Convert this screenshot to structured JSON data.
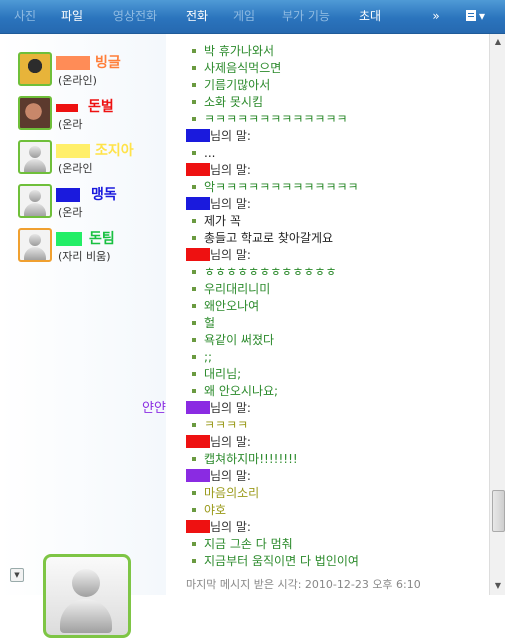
{
  "tabs": [
    {
      "label": "사진"
    },
    {
      "label": "파일"
    },
    {
      "label": "영상전화"
    },
    {
      "label": "전화"
    },
    {
      "label": "게임"
    },
    {
      "label": "부가 기능"
    },
    {
      "label": "초대"
    }
  ],
  "toolbar": {
    "more_label": "»",
    "menu_icon": "menu-icon",
    "menu_arrow": "▾"
  },
  "contacts": [
    {
      "name": "빙글",
      "name_color": "#ff7f3a",
      "status": "(온라인)",
      "redact_color": "#ff8c57"
    },
    {
      "name": "돈벌",
      "name_color": "#ee1111",
      "status": "(온라",
      "redact_color": "#ee1111"
    },
    {
      "name": "조지아",
      "name_color": "#ffe34a",
      "status": "(온라인",
      "redact_color": "#ffef6a"
    },
    {
      "name": "맹독",
      "name_color": "#1a1add",
      "status": "(온라",
      "redact_color": "#1a1add"
    },
    {
      "name": "돈팀",
      "name_color": "#18c040",
      "status": "(자리 비움)",
      "redact_color": "#22ee66"
    }
  ],
  "messages": [
    {
      "type": "msg",
      "text": "박 휴가나와서",
      "color": "green"
    },
    {
      "type": "msg",
      "text": "사제음식먹으면",
      "color": "green"
    },
    {
      "type": "msg",
      "text": "기름기많아서",
      "color": "green"
    },
    {
      "type": "msg",
      "text": "소화 못시킴",
      "color": "green"
    },
    {
      "type": "msg",
      "text": "ㅋㅋㅋㅋㅋㅋㅋㅋㅋㅋㅋㅋㅋ",
      "color": "green"
    },
    {
      "type": "sender",
      "text": "님의 말:",
      "block": "#1a1add"
    },
    {
      "type": "msg",
      "text": "...",
      "color": "black"
    },
    {
      "type": "sender",
      "text": "님의 말:",
      "block": "#ee1111"
    },
    {
      "type": "msg",
      "text": "악ㅋㅋㅋㅋㅋㅋㅋㅋㅋㅋㅋㅋㅋ",
      "color": "green"
    },
    {
      "type": "sender",
      "text": "님의 말:",
      "block": "#1a1add"
    },
    {
      "type": "msg",
      "text": "제가 꼭",
      "color": "black"
    },
    {
      "type": "msg",
      "text": "총들고 학교로 찾아갈게요",
      "color": "black"
    },
    {
      "type": "sender",
      "text": "님의 말:",
      "block": "#ee1111"
    },
    {
      "type": "msg",
      "text": "ㅎㅎㅎㅎㅎㅎㅎㅎㅎㅎㅎㅎ",
      "color": "green"
    },
    {
      "type": "msg",
      "text": "우리대리니미",
      "color": "green"
    },
    {
      "type": "msg",
      "text": "왜안오나여",
      "color": "green"
    },
    {
      "type": "msg",
      "text": "헐",
      "color": "green"
    },
    {
      "type": "msg",
      "text": "욕같이 써졌다",
      "color": "green"
    },
    {
      "type": "msg",
      "text": ";;",
      "color": "green"
    },
    {
      "type": "msg",
      "text": "대리님;",
      "color": "green"
    },
    {
      "type": "msg",
      "text": "왜 안오시나요;",
      "color": "green"
    },
    {
      "type": "sender",
      "text": "님의 말:",
      "block": "#8a2be2",
      "alias": "얀얀"
    },
    {
      "type": "msg",
      "text": "ㅋㅋㅋㅋ",
      "color": "olive"
    },
    {
      "type": "sender",
      "text": "님의 말:",
      "block": "#ee1111"
    },
    {
      "type": "msg",
      "text": "캡쳐하지마!!!!!!!!",
      "color": "green"
    },
    {
      "type": "sender",
      "text": "님의 말:",
      "block": "#8a2be2"
    },
    {
      "type": "msg",
      "text": "마음의소리",
      "color": "olive"
    },
    {
      "type": "msg",
      "text": "야호",
      "color": "olive"
    },
    {
      "type": "sender",
      "text": "님의 말:",
      "block": "#ee1111"
    },
    {
      "type": "msg",
      "text": "지금 그손 다 멈춰",
      "color": "green"
    },
    {
      "type": "msg",
      "text": "지금부터 움직이면 다 법인이여",
      "color": "green"
    }
  ],
  "footer": {
    "text": "마지막 메시지 받은 시각: 2010-12-23 오후 6:10"
  },
  "colors": {
    "green": "#2b8a2b",
    "black": "#222222",
    "olive": "#9a9a1a",
    "tabbar": "#2b74bd"
  }
}
